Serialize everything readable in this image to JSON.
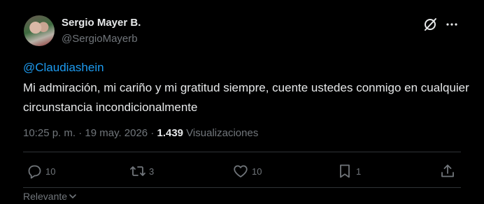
{
  "author": {
    "name": "Sergio Mayer B.",
    "handle": "@SergioMayerb"
  },
  "icons": {
    "grok": "grok-icon",
    "more": "more-icon",
    "reply": "reply-icon",
    "retweet": "retweet-icon",
    "like": "heart-icon",
    "bookmark": "bookmark-icon",
    "share": "share-icon",
    "sort": "chevron-down-icon"
  },
  "tweet": {
    "mention": "@Claudiashein",
    "text": "Mi admiración, mi cariño y mi gratitud siempre, cuente ustedes conmigo en cualquier circunstancia incondicionalmente",
    "timestamp": "10:25 p. m. · 19 may. 2026 · ",
    "views_count": "1.439",
    "views_label": " Visualizaciones"
  },
  "actions": {
    "replies": "10",
    "retweets": "3",
    "likes": "10",
    "bookmarks": "1"
  },
  "sort": {
    "label": "Relevante"
  },
  "colors": {
    "background": "#000000",
    "text": "#e7e9ea",
    "muted": "#71767b",
    "link": "#1d9bf0",
    "divider": "#2f3336"
  }
}
